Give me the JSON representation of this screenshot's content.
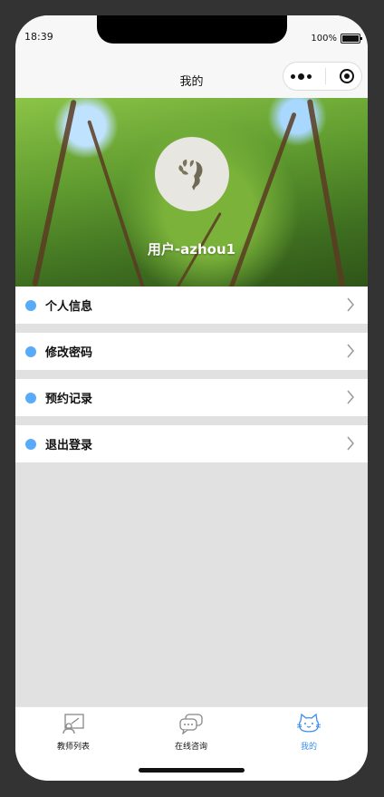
{
  "status": {
    "time": "18:39",
    "battery": "100%"
  },
  "navbar": {
    "title": "我的"
  },
  "profile": {
    "username": "用户-azhou1"
  },
  "menu": [
    {
      "label": "个人信息"
    },
    {
      "label": "修改密码"
    },
    {
      "label": "预约记录"
    },
    {
      "label": "退出登录"
    }
  ],
  "tabbar": {
    "items": [
      {
        "label": "教师列表",
        "icon": "teacher-board-icon"
      },
      {
        "label": "在线咨询",
        "icon": "chat-bubbles-icon"
      },
      {
        "label": "我的",
        "icon": "cat-face-icon",
        "active": true
      }
    ]
  },
  "colors": {
    "accent": "#3b8ff0",
    "menu_dot": "#5aabf7",
    "page_bg": "#e1e1e1"
  }
}
